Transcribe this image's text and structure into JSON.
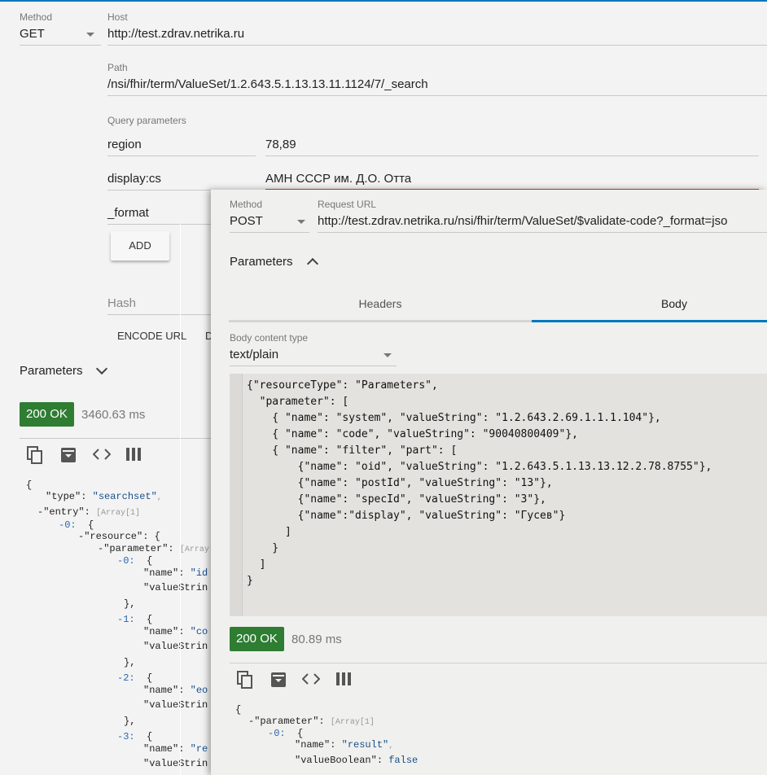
{
  "back": {
    "method_label": "Method",
    "method_value": "GET",
    "host_label": "Host",
    "host_value": "http://test.zdrav.netrika.ru",
    "path_label": "Path",
    "path_value": "/nsi/fhir/term/ValueSet/1.2.643.5.1.13.13.11.1124/7/_search",
    "query_label": "Query parameters",
    "query_params": [
      {
        "name": "region",
        "value": "78,89"
      },
      {
        "name": "display:cs",
        "value": "АМН СССР им. Д.О. Отта"
      },
      {
        "name": "_format",
        "value": ""
      }
    ],
    "add_button": "ADD",
    "hash_placeholder": "Hash",
    "encode_url": "ENCODE URL",
    "decode_partial": "D",
    "parameters_label": "Parameters",
    "status": "200 OK",
    "time": "3460.63 ms",
    "response_lines": [
      "{",
      "\"type\": \"searchset\",",
      "\"entry\": [Array[1]",
      "0:  {",
      "\"resource\": {",
      "\"parameter\": [Array",
      "0:  {",
      "\"name\": \"id",
      "\"valueStrin",
      "},",
      "1:  {",
      "\"name\": \"co",
      "\"valueStrin",
      "},",
      "2:  {",
      "\"name\": \"eo",
      "\"valueStrin",
      "},",
      "3:  {",
      "\"name\": \"re",
      "\"valueStrin"
    ]
  },
  "front": {
    "method_label": "Method",
    "method_value": "POST",
    "url_label": "Request URL",
    "url_value": "http://test.zdrav.netrika.ru/nsi/fhir/term/ValueSet/$validate-code?_format=jso",
    "parameters_label": "Parameters",
    "tabs": [
      {
        "label": "Headers",
        "active": false
      },
      {
        "label": "Body",
        "active": true
      }
    ],
    "body_type_label": "Body content type",
    "body_type_value": "text/plain",
    "body_text": "{\"resourceType\": \"Parameters\",\n  \"parameter\": [\n    { \"name\": \"system\", \"valueString\": \"1.2.643.2.69.1.1.1.104\"},\n    { \"name\": \"code\", \"valueString\": \"90040800409\"},\n    { \"name\": \"filter\", \"part\": [\n        {\"name\": \"oid\", \"valueString\": \"1.2.643.5.1.13.13.12.2.78.8755\"},\n        {\"name\": \"postId\", \"valueString\": \"13\"},\n        {\"name\": \"specId\", \"valueString\": \"3\"},\n        {\"name\":\"display\", \"valueString\": \"Гусев\"}\n      ]\n    }\n  ]\n}",
    "status": "200 OK",
    "time": "80.89 ms",
    "response_open": "{",
    "response_parameter_key": "\"parameter\"",
    "response_array_badge": "[Array[1]",
    "response_index": "-0:",
    "response_name_key": "\"name\"",
    "response_name_value": "\"result\"",
    "response_bool_key": "\"valueBoolean\"",
    "response_bool_value": "false"
  },
  "colors": {
    "accent": "#0277bd",
    "success": "#2e7d32",
    "error_underline": "#d84315"
  },
  "icons": [
    "copy-icon",
    "archive-icon",
    "code-icon",
    "columns-icon",
    "chevron-down-icon",
    "chevron-up-icon"
  ]
}
